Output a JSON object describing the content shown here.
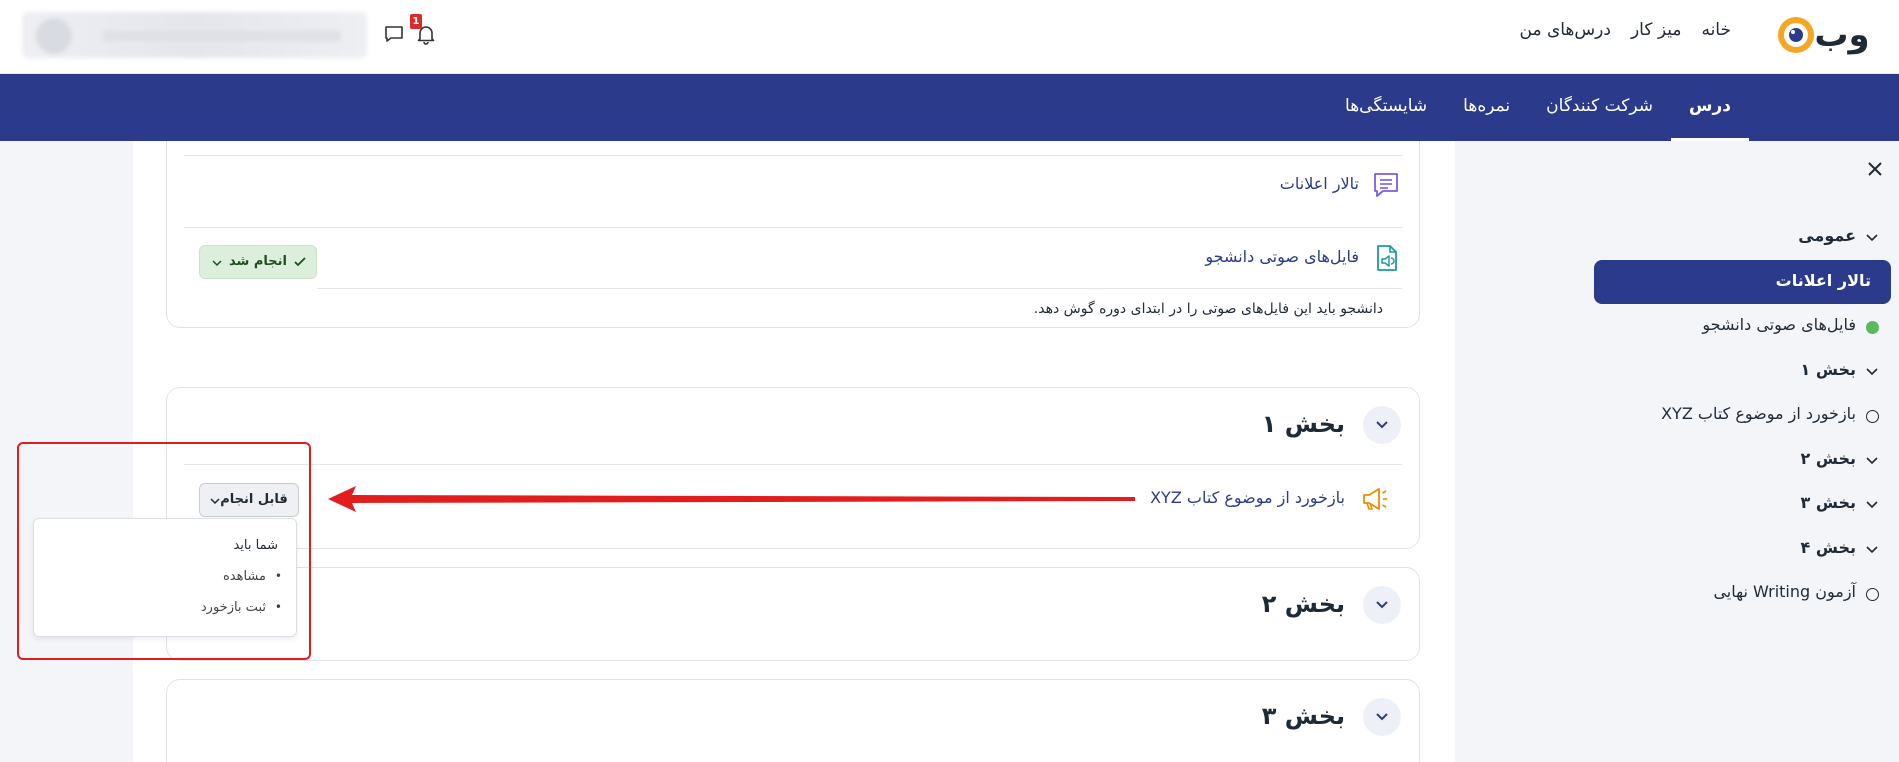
{
  "topbar": {
    "logo_text": "وب",
    "nav": [
      "خانه",
      "میز کار",
      "درس‌های من"
    ],
    "notification_count": "1"
  },
  "course_nav": {
    "tabs": [
      {
        "label": "درس",
        "active": true
      },
      {
        "label": "شرکت کنندگان",
        "active": false
      },
      {
        "label": "نمره‌ها",
        "active": false
      },
      {
        "label": "شایستگی‌ها",
        "active": false
      }
    ]
  },
  "general_section": {
    "activities": [
      {
        "title": "تالار اعلانات",
        "icon": "forum-icon"
      },
      {
        "title": "فایل‌های صوتی دانشجو",
        "icon": "audio-file-icon",
        "status": "انجام شد",
        "description": "دانشجو باید این فایل‌های صوتی را در ابتدای دوره گوش دهد."
      }
    ]
  },
  "section1": {
    "title": "بخش ۱",
    "activity": {
      "title": "بازخورد از موضوع کتاب XYZ",
      "icon": "megaphone-icon",
      "status": "قابل انجام"
    },
    "popover": {
      "title": "شما باید",
      "items": [
        "مشاهده",
        "ثبت بازخورد"
      ]
    }
  },
  "section2": {
    "title": "بخش ۲"
  },
  "section3": {
    "title": "بخش ۳"
  },
  "sidebar": {
    "items": [
      {
        "label": "عمومی",
        "type": "section"
      },
      {
        "label": "تالار اعلانات",
        "type": "active"
      },
      {
        "label": "فایل‌های صوتی دانشجو",
        "type": "done"
      },
      {
        "label": "بخش ۱",
        "type": "section"
      },
      {
        "label": "بازخورد از موضوع کتاب XYZ",
        "type": "todo"
      },
      {
        "label": "بخش ۲",
        "type": "section"
      },
      {
        "label": "بخش ۳",
        "type": "section"
      },
      {
        "label": "بخش ۴",
        "type": "section"
      },
      {
        "label": "آزمون Writing نهایی",
        "type": "todo"
      }
    ]
  },
  "colors": {
    "primary": "#2b3a8a",
    "done_bg": "#dcefdc",
    "annotation_red": "#e11d1d"
  }
}
